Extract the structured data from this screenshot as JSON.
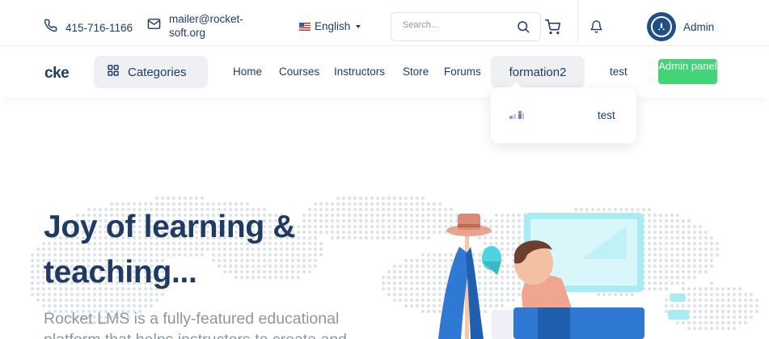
{
  "topbar": {
    "phone": "415-716-1166",
    "email": "mailer@rocket-soft.org",
    "language": "English",
    "search_placeholder": "Search...",
    "user_name": "Admin",
    "icons": {
      "phone": "phone-icon",
      "mail": "mail-icon",
      "flag": "us-flag-icon",
      "search": "search-icon",
      "cart": "cart-icon",
      "bell": "bell-icon",
      "avatar": "user-avatar"
    }
  },
  "nav": {
    "logo": "cke",
    "categories_label": "Categories",
    "links": [
      "Home",
      "Courses",
      "Instructors",
      "Store",
      "Forums"
    ],
    "active_item": "formation2",
    "extra_link": "test",
    "admin_button": "Admin panel"
  },
  "dropdown": {
    "items": [
      {
        "label": "test"
      }
    ]
  },
  "hero": {
    "title": "Joy of learning & teaching...",
    "subtitle": "Rocket LMS is a fully-featured educational platform that helps instructors to create and"
  },
  "colors": {
    "primary": "#1f3b64",
    "accent_green": "#43d477",
    "muted": "#8c97a5",
    "chip_bg": "#eef0f3"
  }
}
